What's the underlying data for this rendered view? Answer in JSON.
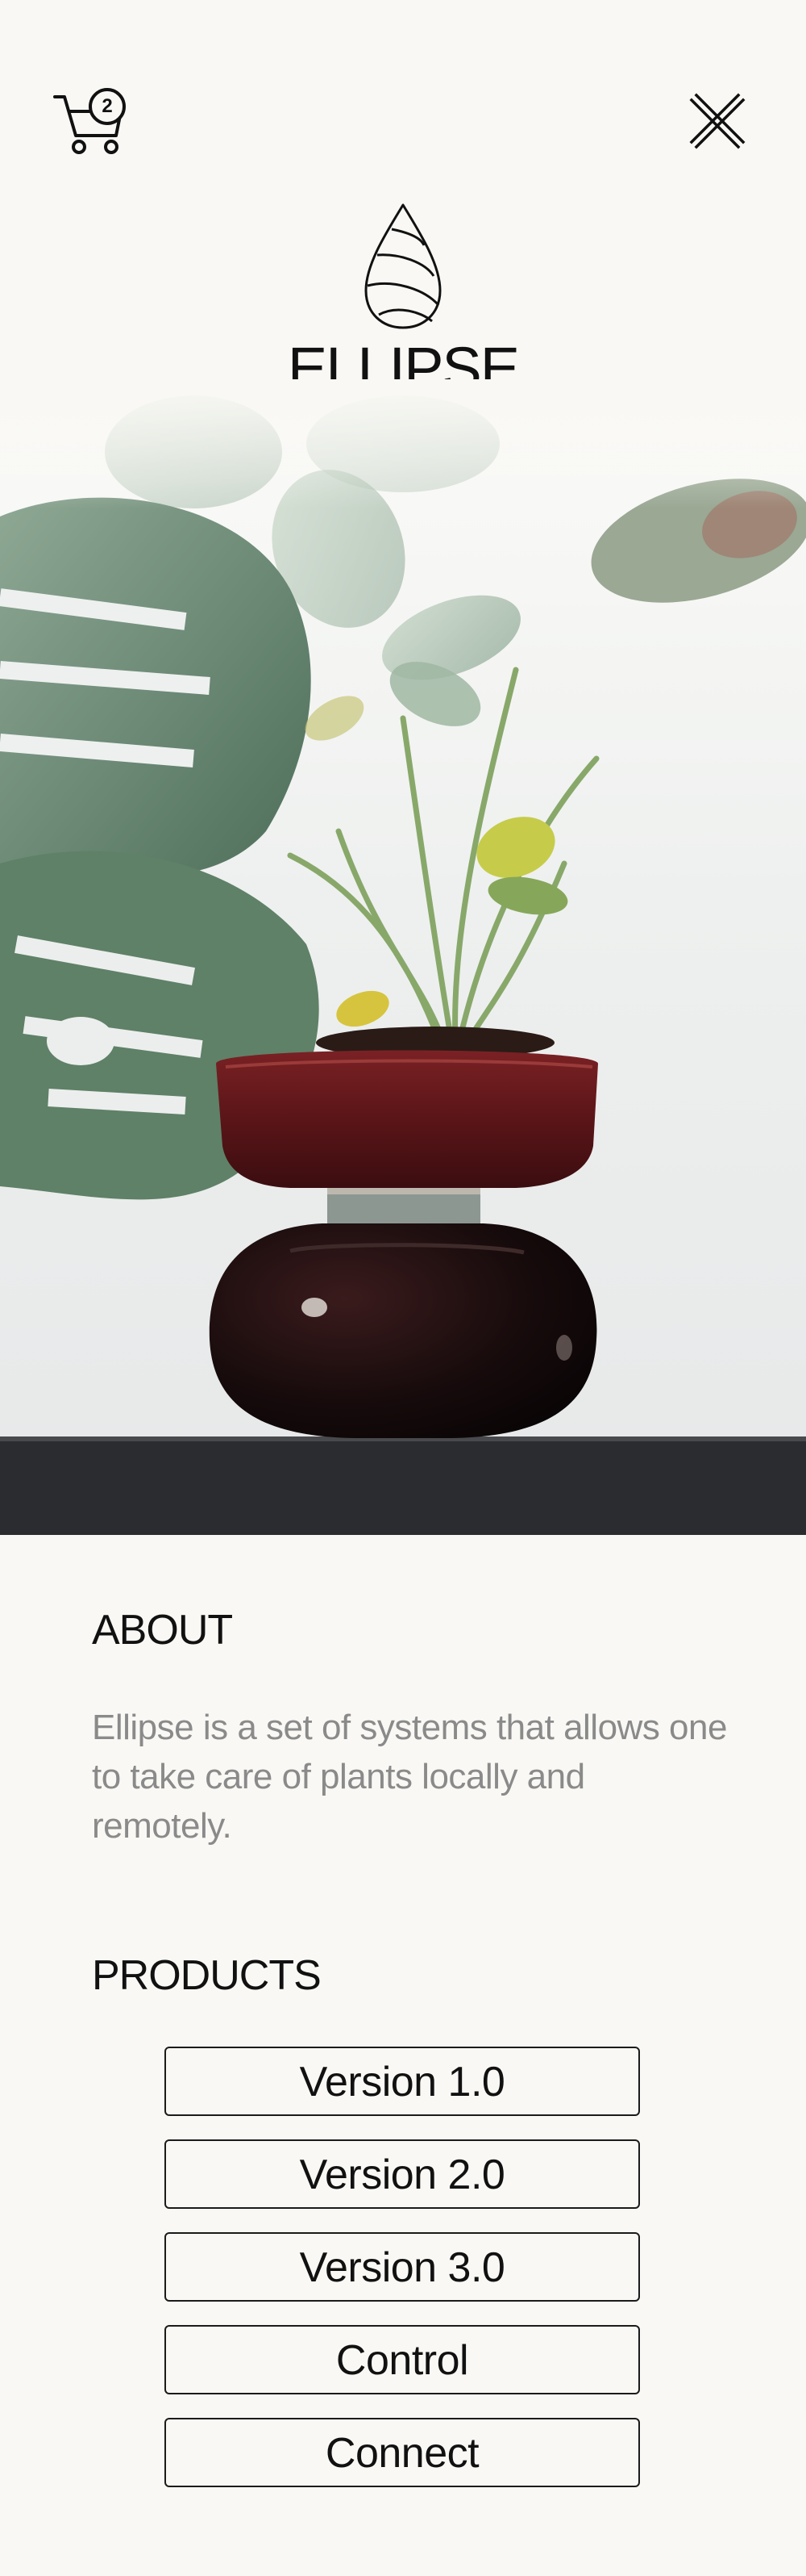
{
  "header": {
    "cart_count": "2",
    "brand_name": "ELLIPSE"
  },
  "about": {
    "title": "ABOUT",
    "text": "Ellipse is a set of systems that allows one to take care of plants locally and remotely."
  },
  "products": {
    "title": "PRODUCTS",
    "items": [
      {
        "label": "Version 1.0"
      },
      {
        "label": "Version 2.0"
      },
      {
        "label": "Version 3.0"
      },
      {
        "label": "Control"
      },
      {
        "label": "Connect"
      }
    ]
  },
  "icons": {
    "cart": "cart-icon",
    "close": "close-icon",
    "logo": "drop-logo"
  },
  "colors": {
    "background": "#f9f8f4",
    "text": "#111111",
    "muted_text": "#8a8a8a",
    "pot": "#5a1518"
  }
}
